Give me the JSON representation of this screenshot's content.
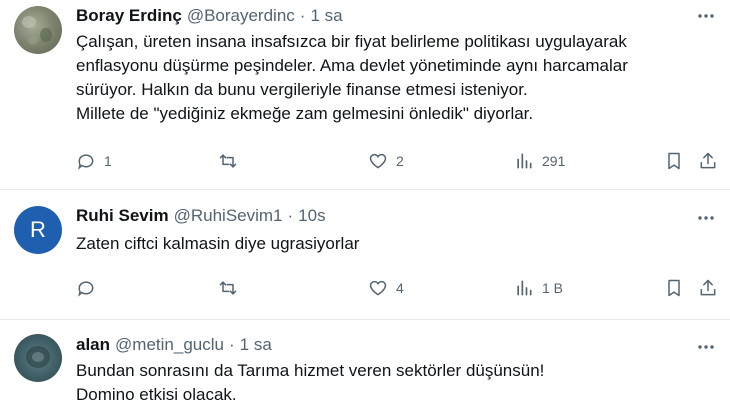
{
  "tweets": [
    {
      "name": "Boray Erdinç",
      "handle": "@Borayerdinc",
      "dot": "·",
      "time": "1 sa",
      "avatar": {
        "kind": "photo",
        "letter": ""
      },
      "lines": [
        "Çalışan, üreten insana insafsızca bir fiyat belirleme politikası uygulayarak",
        "enflasyonu düşürme peşindeler. Ama devlet yönetiminde aynı harcamalar",
        "sürüyor. Halkın da bunu vergileriyle finanse etmesi isteniyor.",
        "Millete de \"yediğiniz ekmeğe zam gelmesini önledik\" diyorlar."
      ],
      "reply_count": "1",
      "retweet_count": "",
      "like_count": "2",
      "view_count": "291"
    },
    {
      "name": "Ruhi Sevim",
      "handle": "@RuhiSevim1",
      "dot": "·",
      "time": "10s",
      "avatar": {
        "kind": "letter",
        "letter": "R"
      },
      "lines": [
        "Zaten ciftci kalmasin diye ugrasiyorlar"
      ],
      "reply_count": "",
      "retweet_count": "",
      "like_count": "4",
      "view_count": "1 B"
    },
    {
      "name": "alan",
      "handle": "@metin_guclu",
      "dot": "·",
      "time": "1 sa",
      "avatar": {
        "kind": "photo",
        "letter": ""
      },
      "lines": [
        "Bundan sonrasını da Tarıma hizmet veren sektörler düşünsün!",
        "Domino etkisi olacak."
      ]
    }
  ],
  "colors": {
    "text": "#0f1419",
    "secondary": "#536471",
    "divider": "#e6ecf0",
    "letter_avatar": "#1f5fb0"
  },
  "icons": [
    "more-icon",
    "reply-icon",
    "retweet-icon",
    "like-icon",
    "views-icon",
    "bookmark-icon",
    "share-icon"
  ]
}
